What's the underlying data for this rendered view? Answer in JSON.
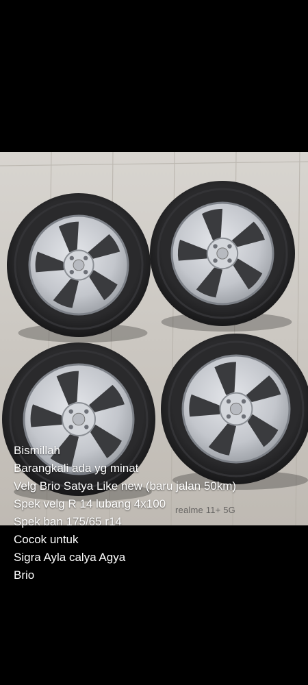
{
  "photo": {
    "subject": "four alloy wheels with tires on tiled floor",
    "watermark": "realme 11+ 5G"
  },
  "caption": {
    "lines": [
      "Bismillah",
      "Barangkali ada yg minat",
      "Velg Brio Satya Like new (baru jalan 50km)",
      "Spek velg R 14 lubang 4x100",
      "Spek ban 175/65 r14",
      "Cocok untuk",
      "Sigra Ayla calya Agya",
      "Brio"
    ]
  },
  "colors": {
    "background": "#000000",
    "caption_text": "#ffffff",
    "tire": "#1c1c1e",
    "rim": "#c9ccd1"
  }
}
